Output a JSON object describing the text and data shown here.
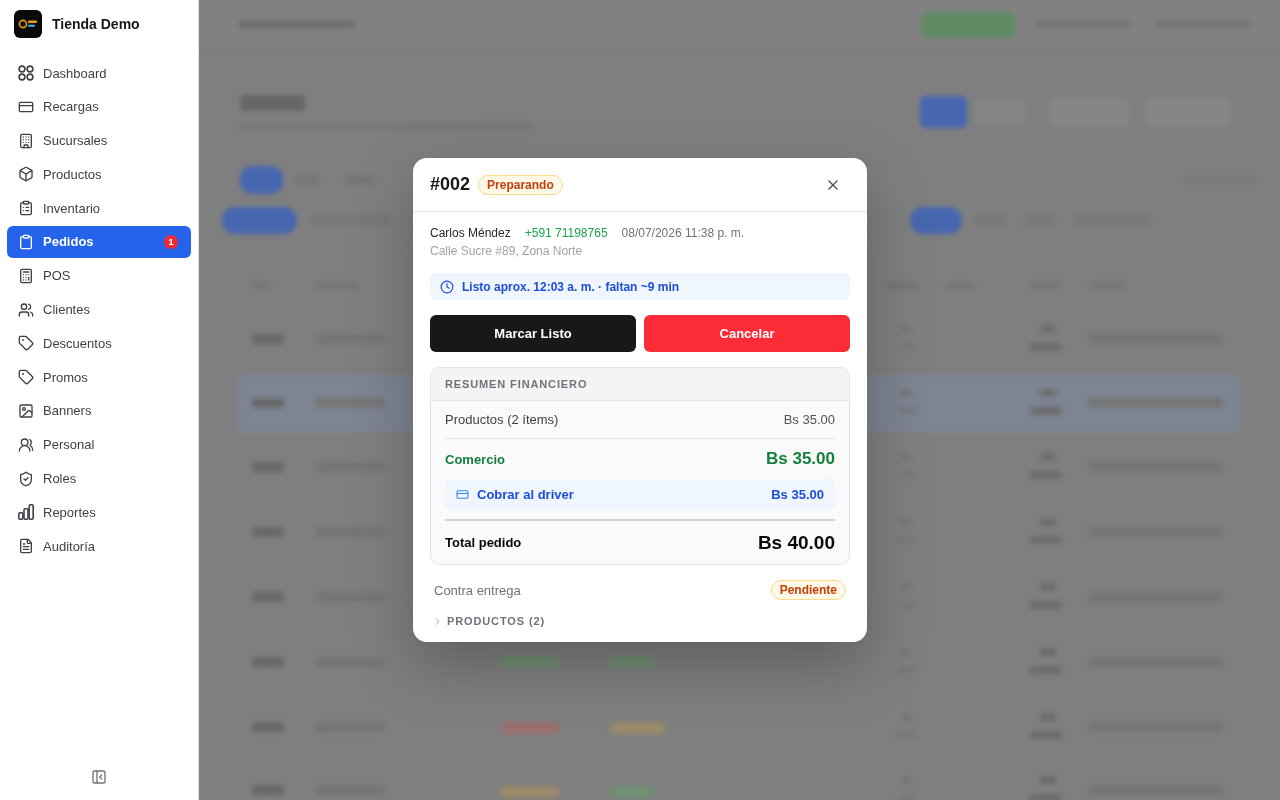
{
  "sidebar": {
    "store_name": "Tienda Demo",
    "items": [
      {
        "label": "Dashboard",
        "selected": false
      },
      {
        "label": "Recargas",
        "selected": false
      },
      {
        "label": "Sucursales",
        "selected": false
      },
      {
        "label": "Productos",
        "selected": false
      },
      {
        "label": "Inventario",
        "selected": false
      },
      {
        "label": "Pedidos",
        "selected": true,
        "badge": "1"
      },
      {
        "label": "POS",
        "selected": false
      },
      {
        "label": "Clientes",
        "selected": false
      },
      {
        "label": "Descuentos",
        "selected": false
      },
      {
        "label": "Promos",
        "selected": false
      },
      {
        "label": "Banners",
        "selected": false
      },
      {
        "label": "Personal",
        "selected": false
      },
      {
        "label": "Roles",
        "selected": false
      },
      {
        "label": "Reportes",
        "selected": false
      },
      {
        "label": "Auditoría",
        "selected": false
      }
    ]
  },
  "order_dialog": {
    "title": "#002",
    "status": "Preparando",
    "customer": {
      "name": "Carlos Méndez",
      "phone": "+591 71198765",
      "date": "08/07/2026 11:38 p. m.",
      "address": "Calle Sucre #89, Zona Norte"
    },
    "eta_notice": "Listo aprox. 12:03 a. m. · faltan ~9 min",
    "actions": [
      {
        "label": "Marcar Listo",
        "kind": "primary"
      },
      {
        "label": "Cancelar",
        "kind": "danger"
      }
    ],
    "summary": {
      "title": "RESUMEN FINANCIERO",
      "rows": [
        {
          "kind": "plain",
          "label": "Productos (2 ítems)",
          "value": "Bs 35.00"
        },
        {
          "kind": "highlight",
          "label": "Comercio",
          "value": "Bs 35.00"
        },
        {
          "kind": "callout",
          "label": "Cobrar al driver",
          "value": "Bs 35.00"
        },
        {
          "kind": "total",
          "label": "Total pedido",
          "value": "Bs 40.00"
        }
      ]
    },
    "payment": {
      "label": "Contra entrega",
      "status": "Pendiente"
    },
    "products_section": {
      "label": "PRODUCTOS (2)",
      "expanded": false
    }
  }
}
